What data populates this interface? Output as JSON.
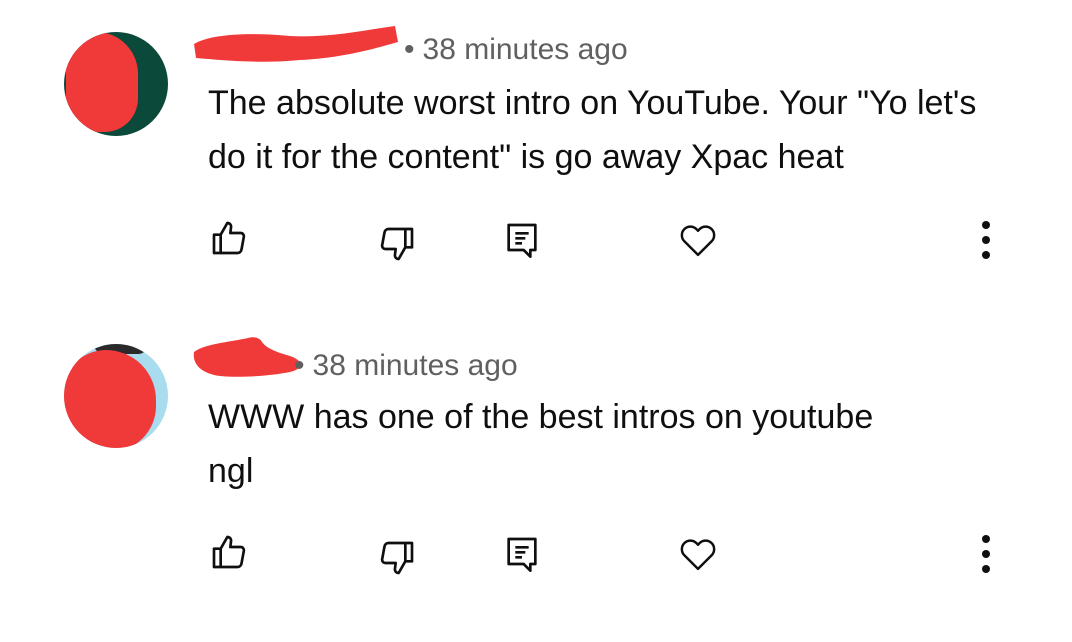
{
  "comments": [
    {
      "author": "",
      "separator": "•",
      "time": "38 minutes ago",
      "text": "The absolute worst intro on YouTube. Your \"Yo let's do it for the content\" is go away Xpac heat",
      "actions": [
        "like-icon",
        "dislike-icon",
        "reply-icon",
        "heart-icon",
        "more-icon"
      ]
    },
    {
      "author": "",
      "separator": "•",
      "time": "38 minutes ago",
      "text": "WWW has one of the best intros on youtube ngl",
      "actions": [
        "like-icon",
        "dislike-icon",
        "reply-icon",
        "heart-icon",
        "more-icon"
      ]
    }
  ],
  "colors": {
    "redaction": "#f03a3a",
    "avatar1_bg": "#0b4a3a",
    "avatar2_bg": "#a9dcef",
    "text": "#0f0f0f",
    "meta": "#606060"
  }
}
